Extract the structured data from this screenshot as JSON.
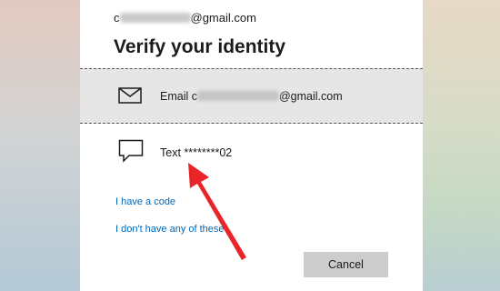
{
  "account": {
    "email_prefix": "c",
    "email_suffix": "@gmail.com"
  },
  "title": "Verify your identity",
  "options": [
    {
      "icon": "envelope-icon",
      "label_prefix": "Email c",
      "label_suffix": "@gmail.com",
      "selected": true
    },
    {
      "icon": "chat-bubble-icon",
      "label": "Text ********02",
      "selected": false
    }
  ],
  "links": {
    "have_code": "I have a code",
    "dont_have": "I don't have any of these"
  },
  "buttons": {
    "cancel": "Cancel"
  },
  "colors": {
    "accent_link": "#0067b8",
    "selected_bg": "#e6e6e6",
    "annotation_arrow": "#e8262a"
  }
}
